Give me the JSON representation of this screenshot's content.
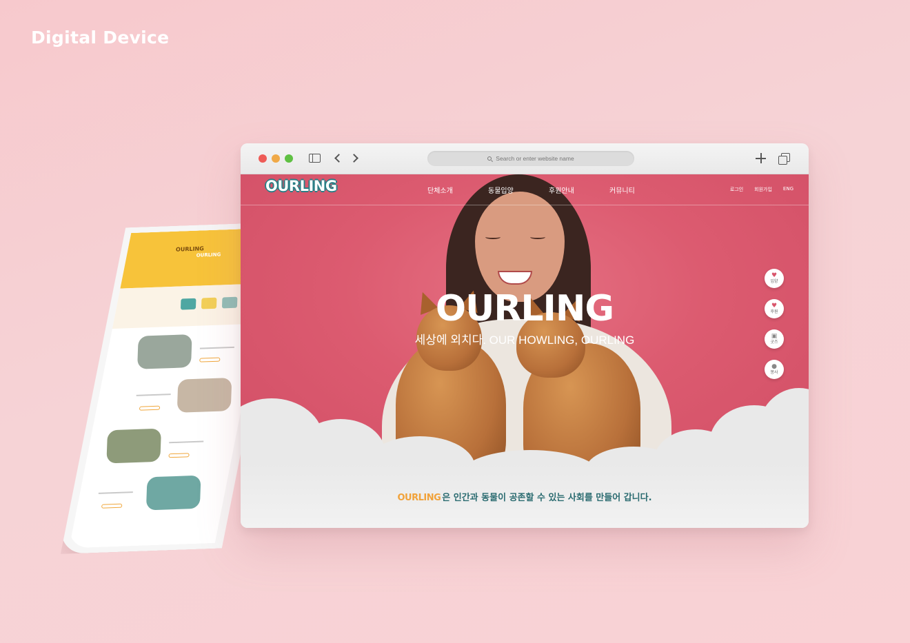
{
  "presentation": {
    "title": "Digital Device"
  },
  "browser": {
    "url_placeholder": "Search or enter website name"
  },
  "site": {
    "logo": "OURLING",
    "nav": [
      "단체소개",
      "동물입양",
      "후원안내",
      "커뮤니티"
    ],
    "util": [
      "로그인",
      "회원가입",
      "ENG"
    ],
    "hero": {
      "brand": "OURLING",
      "tagline": "세상에 외치다. OUR HOWLING, OURLING"
    },
    "quick_menu": [
      {
        "icon": "heart-icon",
        "label": "입양"
      },
      {
        "icon": "donate-icon",
        "label": "후원"
      },
      {
        "icon": "gift-icon",
        "label": "굿즈"
      },
      {
        "icon": "volunteer-icon",
        "label": "봉사"
      }
    ],
    "intro": {
      "brand": "OURLING",
      "text": "은 인간과 동물이 공존할 수 있는 사회를 만들어 갑니다."
    }
  },
  "colors": {
    "hero_pink": "#dc5b70",
    "brand_teal": "#2a6b70",
    "brand_orange": "#f1a23a",
    "mobile_yellow": "#f7c33a"
  },
  "mobile": {
    "logo": "OURLING",
    "hero_title": "OURLING"
  }
}
